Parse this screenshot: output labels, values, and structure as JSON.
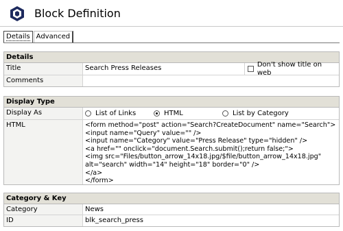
{
  "header": {
    "title": "Block Definition",
    "logo_icon": "hexagon-logo-icon"
  },
  "tabs": [
    {
      "label": "Details",
      "active": true
    },
    {
      "label": "Advanced",
      "active": false
    }
  ],
  "details": {
    "heading": "Details",
    "title_label": "Title",
    "title_value": "Search Press Releases",
    "dont_show_label": "Don't show title on web",
    "dont_show_checked": false,
    "comments_label": "Comments",
    "comments_value": ""
  },
  "display_type": {
    "heading": "Display Type",
    "display_as_label": "Display As",
    "options": [
      {
        "label": "List of Links",
        "checked": false
      },
      {
        "label": "HTML",
        "checked": true
      },
      {
        "label": "List by Category",
        "checked": false
      }
    ],
    "html_label": "HTML",
    "html_lines": [
      "<form method=\"post\" action=\"Search?CreateDocument\" name=\"Search\">",
      "<input name=\"Query\" value=\"\" />",
      "<input name=\"Category\" value=\"Press Release\" type=\"hidden\" />",
      "<a href=\"\" onclick=\"document.Search.submit();return false;\">",
      "<img src=\"Files/button_arrow_14x18.jpg/$file/button_arrow_14x18.jpg\"",
      "alt=\"search\" width=\"14\" height=\"18\" border=\"0\" />",
      "</a>",
      "</form>"
    ]
  },
  "category_key": {
    "heading": "Category & Key",
    "category_label": "Category",
    "category_value": "News",
    "id_label": "ID",
    "id_value": "blk_search_press"
  }
}
